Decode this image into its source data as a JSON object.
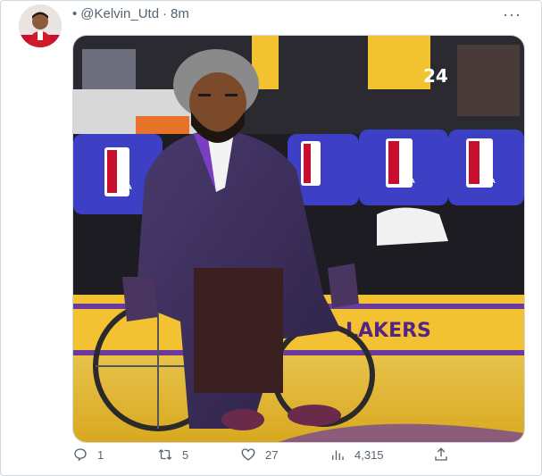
{
  "tweet": {
    "handle": "@Kelvin_Utd",
    "separator": "·",
    "time": "8m",
    "more_label": "···",
    "image_signage": {
      "lakers_logo": "LAKERS",
      "jersey_number": "24",
      "nba_logo_text": "NBA"
    }
  },
  "actions": {
    "replies": "1",
    "retweets": "5",
    "likes": "27",
    "views": "4,315"
  },
  "colors": {
    "lakers_purple": "#552583",
    "lakers_gold": "#fdb927",
    "text_secondary": "#536471",
    "border": "#cfd9de"
  },
  "icons": [
    "reply-icon",
    "retweet-icon",
    "like-icon",
    "views-icon",
    "share-icon",
    "more-icon"
  ]
}
